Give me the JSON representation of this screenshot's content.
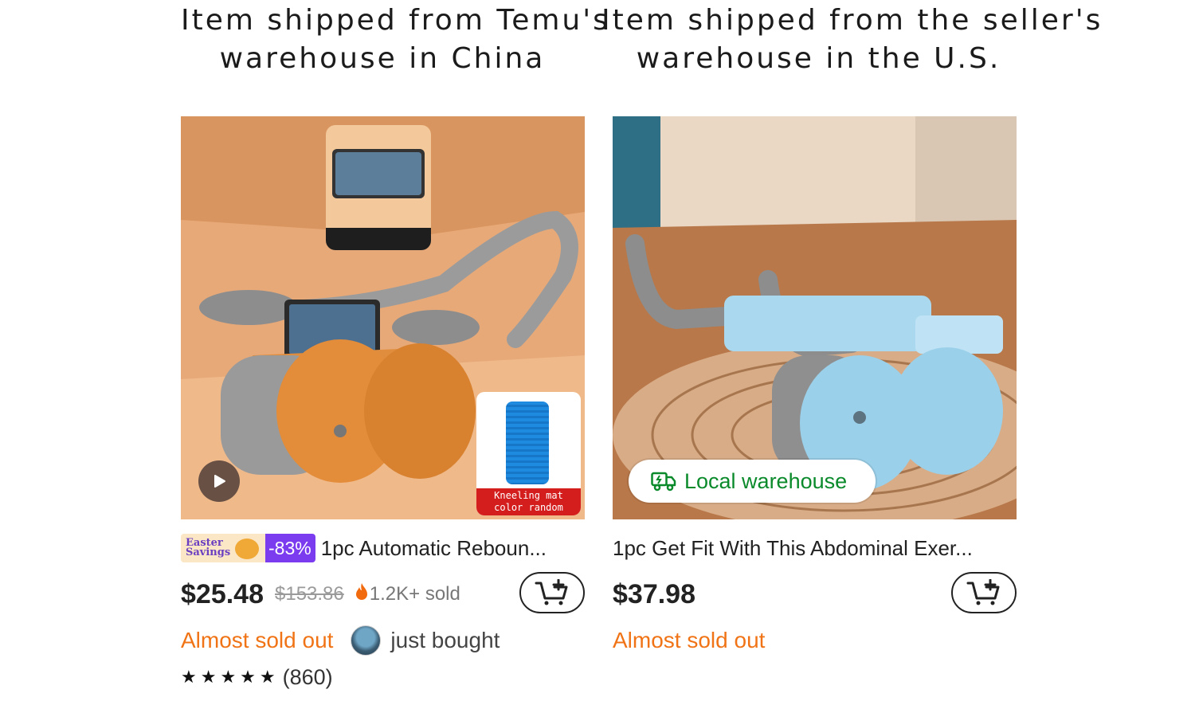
{
  "headings": {
    "left_line1": "Item shipped from Temu's",
    "left_line2": "warehouse in China",
    "right_line1": "Item shipped from the seller's",
    "right_line2": "warehouse in the U.S."
  },
  "products": [
    {
      "promo_label_line1": "Easter",
      "promo_label_line2": "Savings",
      "discount": "-83%",
      "title": "1pc Automatic Reboun...",
      "price": "$25.48",
      "old_price": "$153.86",
      "sold": "1.2K+ sold",
      "stock_status": "Almost sold out",
      "activity": "just bought",
      "stars": "★★★★★",
      "rating_count": "(860)",
      "image_caption_line1": "Kneeling mat",
      "image_caption_line2": "color random",
      "icons": [
        "play-icon",
        "flame-icon",
        "add-to-cart-icon"
      ],
      "colors": {
        "product": "#e59a52",
        "accent": "#7b3cf0"
      }
    },
    {
      "title": "1pc Get Fit With This Abdominal Exer...",
      "price": "$37.98",
      "stock_status": "Almost sold out",
      "badge": "Local warehouse",
      "icons": [
        "truck-icon",
        "add-to-cart-icon"
      ],
      "colors": {
        "product": "#9fd2ec",
        "badge": "#0a8a2a"
      }
    }
  ],
  "colors": {
    "stock_status": "#f07416",
    "sold_flame": "#f26a0e"
  }
}
